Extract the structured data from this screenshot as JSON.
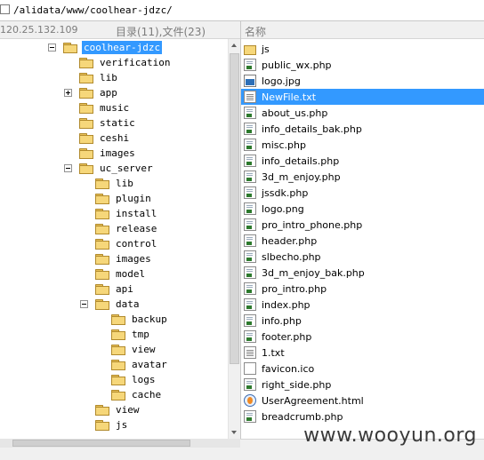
{
  "path_bar": {
    "path": "/alidata/www/coolhear-jdzc/"
  },
  "left_header": {
    "ip": "120.25.132.109",
    "count": "目录(11),文件(23)"
  },
  "right_header": {
    "name_col": "名称"
  },
  "tree": [
    {
      "label": "coolhear-jdzc",
      "depth": 0,
      "expander": "minus",
      "selected": true
    },
    {
      "label": "verification",
      "depth": 1,
      "expander": "none"
    },
    {
      "label": "lib",
      "depth": 1,
      "expander": "none"
    },
    {
      "label": "app",
      "depth": 1,
      "expander": "plus"
    },
    {
      "label": "music",
      "depth": 1,
      "expander": "none"
    },
    {
      "label": "static",
      "depth": 1,
      "expander": "none"
    },
    {
      "label": "ceshi",
      "depth": 1,
      "expander": "none"
    },
    {
      "label": "images",
      "depth": 1,
      "expander": "none"
    },
    {
      "label": "uc_server",
      "depth": 1,
      "expander": "minus"
    },
    {
      "label": "lib",
      "depth": 2,
      "expander": "none"
    },
    {
      "label": "plugin",
      "depth": 2,
      "expander": "none"
    },
    {
      "label": "install",
      "depth": 2,
      "expander": "none"
    },
    {
      "label": "release",
      "depth": 2,
      "expander": "none"
    },
    {
      "label": "control",
      "depth": 2,
      "expander": "none"
    },
    {
      "label": "images",
      "depth": 2,
      "expander": "none"
    },
    {
      "label": "model",
      "depth": 2,
      "expander": "none"
    },
    {
      "label": "api",
      "depth": 2,
      "expander": "none"
    },
    {
      "label": "data",
      "depth": 2,
      "expander": "minus"
    },
    {
      "label": "backup",
      "depth": 3,
      "expander": "none"
    },
    {
      "label": "tmp",
      "depth": 3,
      "expander": "none"
    },
    {
      "label": "view",
      "depth": 3,
      "expander": "none"
    },
    {
      "label": "avatar",
      "depth": 3,
      "expander": "none"
    },
    {
      "label": "logs",
      "depth": 3,
      "expander": "none"
    },
    {
      "label": "cache",
      "depth": 3,
      "expander": "none"
    },
    {
      "label": "view",
      "depth": 2,
      "expander": "none"
    },
    {
      "label": "js",
      "depth": 2,
      "expander": "none"
    }
  ],
  "files": [
    {
      "name": "js",
      "icon": "folder-icon",
      "selected": false
    },
    {
      "name": "public_wx.php",
      "icon": "php-file-icon",
      "selected": false
    },
    {
      "name": "logo.jpg",
      "icon": "image-file-icon",
      "selected": false
    },
    {
      "name": "NewFile.txt",
      "icon": "text-file-icon",
      "selected": true
    },
    {
      "name": "about_us.php",
      "icon": "php-file-icon",
      "selected": false
    },
    {
      "name": "info_details_bak.php",
      "icon": "php-file-icon",
      "selected": false
    },
    {
      "name": "misc.php",
      "icon": "php-file-icon",
      "selected": false
    },
    {
      "name": "info_details.php",
      "icon": "php-file-icon",
      "selected": false
    },
    {
      "name": "3d_m_enjoy.php",
      "icon": "php-file-icon",
      "selected": false
    },
    {
      "name": "jssdk.php",
      "icon": "php-file-icon",
      "selected": false
    },
    {
      "name": "logo.png",
      "icon": "php-file-icon",
      "selected": false
    },
    {
      "name": "pro_intro_phone.php",
      "icon": "php-file-icon",
      "selected": false
    },
    {
      "name": "header.php",
      "icon": "php-file-icon",
      "selected": false
    },
    {
      "name": "slbecho.php",
      "icon": "php-file-icon",
      "selected": false
    },
    {
      "name": "3d_m_enjoy_bak.php",
      "icon": "php-file-icon",
      "selected": false
    },
    {
      "name": "pro_intro.php",
      "icon": "php-file-icon",
      "selected": false
    },
    {
      "name": "index.php",
      "icon": "php-file-icon",
      "selected": false
    },
    {
      "name": "info.php",
      "icon": "php-file-icon",
      "selected": false
    },
    {
      "name": "footer.php",
      "icon": "php-file-icon",
      "selected": false
    },
    {
      "name": "1.txt",
      "icon": "text-file-icon",
      "selected": false
    },
    {
      "name": "favicon.ico",
      "icon": "ico-file-icon",
      "selected": false
    },
    {
      "name": "right_side.php",
      "icon": "php-file-icon",
      "selected": false
    },
    {
      "name": "UserAgreement.html",
      "icon": "html-file-icon",
      "selected": false
    },
    {
      "name": "breadcrumb.php",
      "icon": "php-file-icon",
      "selected": false
    }
  ],
  "watermark": "www.wooyun.org",
  "colors": {
    "selection": "#3399ff",
    "folder": "#f6d77a"
  }
}
